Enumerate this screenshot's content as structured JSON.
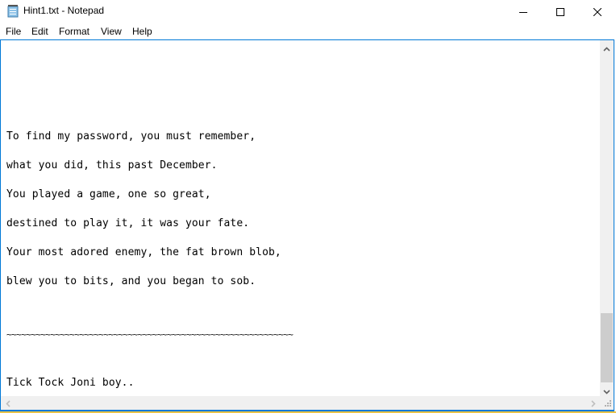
{
  "window": {
    "title": "Hint1.txt - Notepad",
    "app_icon": "notepad-icon",
    "controls": [
      "minimize-icon",
      "maximize-icon",
      "close-icon"
    ]
  },
  "menu": {
    "items": [
      {
        "label": "File"
      },
      {
        "label": "Edit"
      },
      {
        "label": "Format"
      },
      {
        "label": "View"
      },
      {
        "label": "Help"
      }
    ]
  },
  "editor": {
    "lines": [
      "To find my password, you must remember,",
      "what you did, this past December.",
      "You played a game, one so great,",
      "destined to play it, it was your fate.",
      "Your most adored enemy, the fat brown blob,",
      "blew you to bits, and you began to sob.",
      "~~~~~~~~~~~~~~~~~~~~~~~~~~~~~~~~~~~~~~~~~~~~~~~~~~~~~~~~~~~",
      "Tick Tock Joni boy.."
    ],
    "vertical_scroll_position": 0.9
  },
  "colors": {
    "accent": "#0078d7",
    "scrollbar_track": "#f0f0f0",
    "scrollbar_thumb": "#cdcdcd"
  }
}
